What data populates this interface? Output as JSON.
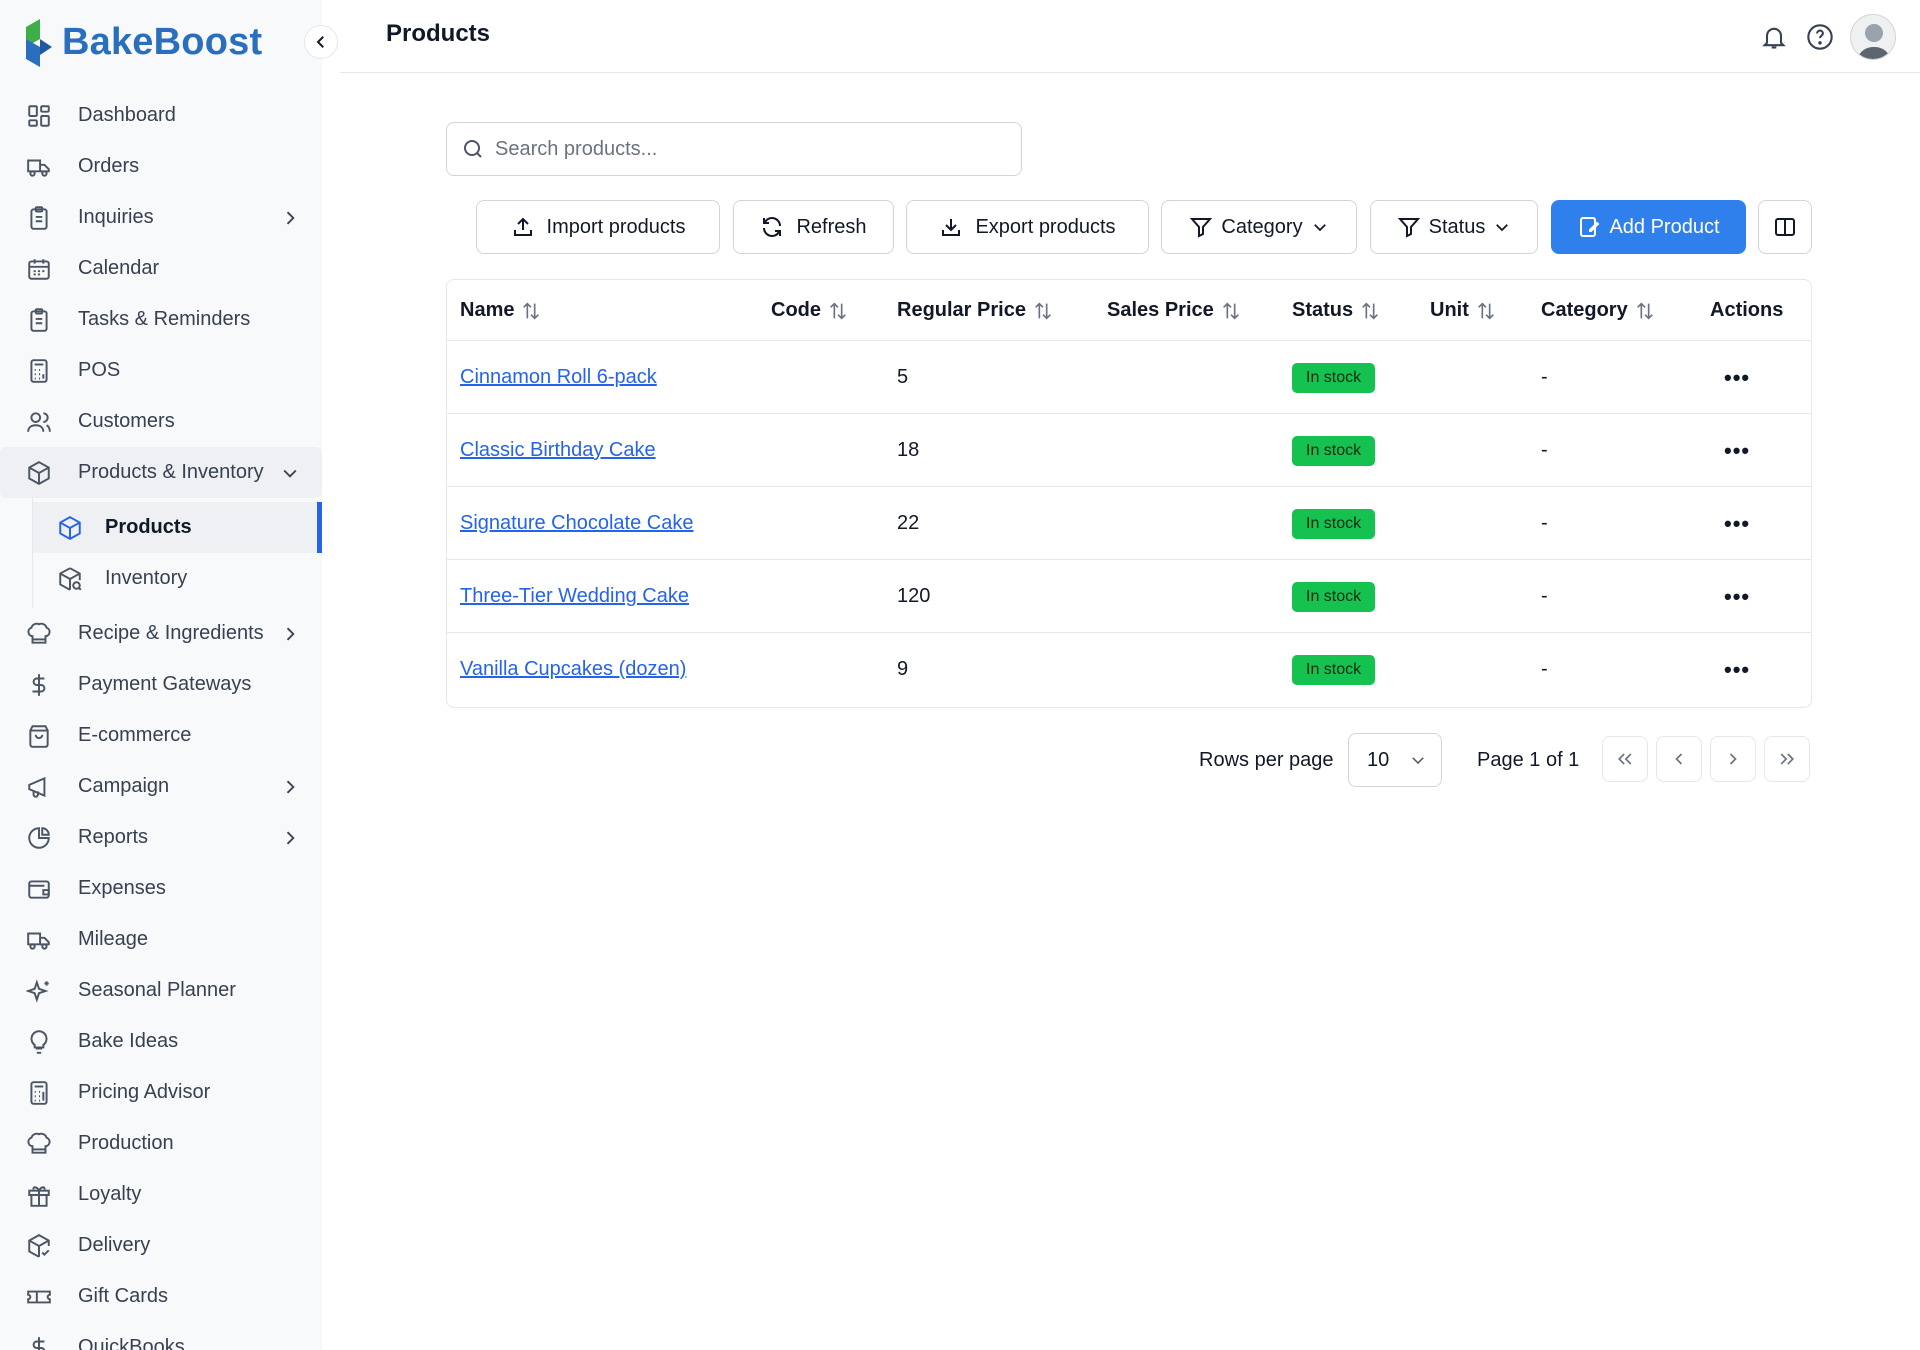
{
  "app": {
    "name": "BakeBoost",
    "brand_color": "#2a6fbd",
    "accent": "#2f80ed"
  },
  "sidebar": {
    "items": [
      {
        "label": "Dashboard",
        "icon": "dashboard-icon"
      },
      {
        "label": "Orders",
        "icon": "truck-icon"
      },
      {
        "label": "Inquiries",
        "icon": "clipboard-icon",
        "has_children": true
      },
      {
        "label": "Calendar",
        "icon": "calendar-icon"
      },
      {
        "label": "Tasks & Reminders",
        "icon": "clipboard-icon"
      },
      {
        "label": "POS",
        "icon": "calculator-icon"
      },
      {
        "label": "Customers",
        "icon": "users-icon"
      },
      {
        "label": "Products & Inventory",
        "icon": "box-icon",
        "expanded": true
      },
      {
        "label": "Recipe & Ingredients",
        "icon": "chef-hat-icon",
        "has_children": true
      },
      {
        "label": "Payment Gateways",
        "icon": "dollar-icon"
      },
      {
        "label": "E-commerce",
        "icon": "shopping-bag-icon"
      },
      {
        "label": "Campaign",
        "icon": "megaphone-icon",
        "has_children": true
      },
      {
        "label": "Reports",
        "icon": "pie-chart-icon",
        "has_children": true
      },
      {
        "label": "Expenses",
        "icon": "wallet-icon"
      },
      {
        "label": "Mileage",
        "icon": "truck-icon"
      },
      {
        "label": "Seasonal Planner",
        "icon": "sparkles-icon"
      },
      {
        "label": "Bake Ideas",
        "icon": "lightbulb-icon"
      },
      {
        "label": "Pricing Advisor",
        "icon": "calculator-icon"
      },
      {
        "label": "Production",
        "icon": "chef-hat-icon"
      },
      {
        "label": "Loyalty",
        "icon": "gift-icon"
      },
      {
        "label": "Delivery",
        "icon": "package-check-icon"
      },
      {
        "label": "Gift Cards",
        "icon": "ticket-icon"
      },
      {
        "label": "QuickBooks",
        "icon": "dollar-icon"
      }
    ],
    "sub_items": [
      {
        "label": "Products",
        "icon": "box-icon",
        "active": true
      },
      {
        "label": "Inventory",
        "icon": "package-search-icon"
      }
    ]
  },
  "header": {
    "title": "Products"
  },
  "search": {
    "placeholder": "Search products..."
  },
  "toolbar": {
    "import": "Import products",
    "refresh": "Refresh",
    "export": "Export products",
    "category": "Category",
    "status": "Status",
    "add": "Add Product"
  },
  "table": {
    "columns": [
      "Name",
      "Code",
      "Regular Price",
      "Sales Price",
      "Status",
      "Unit",
      "Category",
      "Actions"
    ],
    "rows": [
      {
        "name": "Cinnamon Roll 6-pack",
        "code": "",
        "regular_price": "5",
        "sales_price": "",
        "status": "In stock",
        "unit": "",
        "category": "-",
        "actions": "•••"
      },
      {
        "name": "Classic Birthday Cake",
        "code": "",
        "regular_price": "18",
        "sales_price": "",
        "status": "In stock",
        "unit": "",
        "category": "-",
        "actions": "•••"
      },
      {
        "name": "Signature Chocolate Cake",
        "code": "",
        "regular_price": "22",
        "sales_price": "",
        "status": "In stock",
        "unit": "",
        "category": "-",
        "actions": "•••"
      },
      {
        "name": "Three-Tier Wedding Cake",
        "code": "",
        "regular_price": "120",
        "sales_price": "",
        "status": "In stock",
        "unit": "",
        "category": "-",
        "actions": "•••"
      },
      {
        "name": "Vanilla Cupcakes (dozen)",
        "code": "",
        "regular_price": "9",
        "sales_price": "",
        "status": "In stock",
        "unit": "",
        "category": "-",
        "actions": "•••"
      }
    ],
    "status_color": "#16c24f"
  },
  "pagination": {
    "rows_per_page_label": "Rows per page",
    "rows_per_page": "10",
    "page_info": "Page 1 of 1"
  }
}
